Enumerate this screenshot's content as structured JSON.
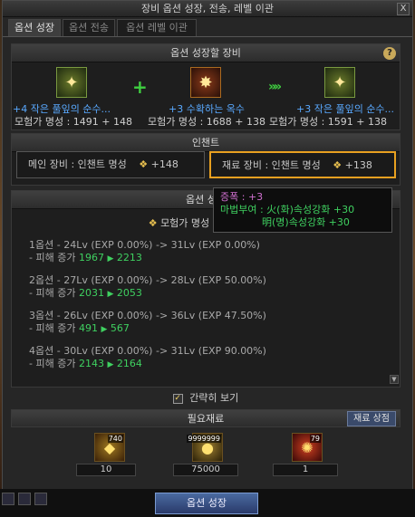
{
  "window": {
    "title": "장비 옵션 성장, 전송, 레벨 이관",
    "close": "X"
  },
  "tabs": [
    {
      "label": "옵션 성장"
    },
    {
      "label": "옵션 전송"
    },
    {
      "label": "옵션 레벨 이관"
    }
  ],
  "equipment": {
    "header": "옵션 성장할 장비",
    "help": "?",
    "plus": "+",
    "arrows": "»»",
    "items": [
      {
        "name": "+4  작은 풀잎의 순수...",
        "fame": "모험가 명성 : 1491 + 148"
      },
      {
        "name": "+3  수확하는 옥수",
        "fame": "모험가 명성 : 1688 + 138"
      },
      {
        "name": "+3  작은 풀잎의 순수...",
        "fame": "모험가 명성 : 1591 + 138"
      }
    ]
  },
  "enchant": {
    "header": "인챈트",
    "main": {
      "label": "메인 장비 : 인챈트 명성",
      "value": "+148"
    },
    "material": {
      "label": "재료 장비 : 인챈트 명성",
      "value": "+138"
    }
  },
  "tooltip": {
    "line1": "증폭 : +3",
    "line2": "마법부여 : 火(화)속성강화 +30",
    "line3": "明(명)속성강화 +30"
  },
  "detail": {
    "header": "옵션 성장",
    "fame": "모험가 명성 : 1491 ▶ 1",
    "options": [
      {
        "title": "1옵션 - 24Lv (EXP 0.00%) -> 31Lv (EXP 0.00%)",
        "dmg_label": "- 피해 증가",
        "from": "1967",
        "to": "2213"
      },
      {
        "title": "2옵션 - 27Lv (EXP 0.00%) -> 28Lv (EXP 50.00%)",
        "dmg_label": "- 피해 증가",
        "from": "2031",
        "to": "2053"
      },
      {
        "title": "3옵션 - 26Lv (EXP 0.00%) -> 36Lv (EXP 47.50%)",
        "dmg_label": "- 피해 증가",
        "from": "491",
        "to": "567"
      },
      {
        "title": "4옵션 - 30Lv (EXP 0.00%) -> 31Lv (EXP 90.00%)",
        "dmg_label": "- 피해 증가",
        "from": "2143",
        "to": "2164"
      }
    ]
  },
  "simple_view": {
    "label": "간략히 보기",
    "checked": true
  },
  "materials": {
    "header": "필요재료",
    "shop_button": "재료 상점",
    "items": [
      {
        "badge": "740",
        "count": "10",
        "icon": "gem-icon"
      },
      {
        "badge": "9999999",
        "count": "75000",
        "icon": "gold-icon"
      },
      {
        "badge": "79",
        "count": "1",
        "icon": "shard-icon"
      }
    ]
  },
  "actions": {
    "grow_button": "옵션 성장"
  },
  "colors": {
    "accent": "#e8a020",
    "item_name": "#59a9ff",
    "increase": "#3fd060"
  }
}
